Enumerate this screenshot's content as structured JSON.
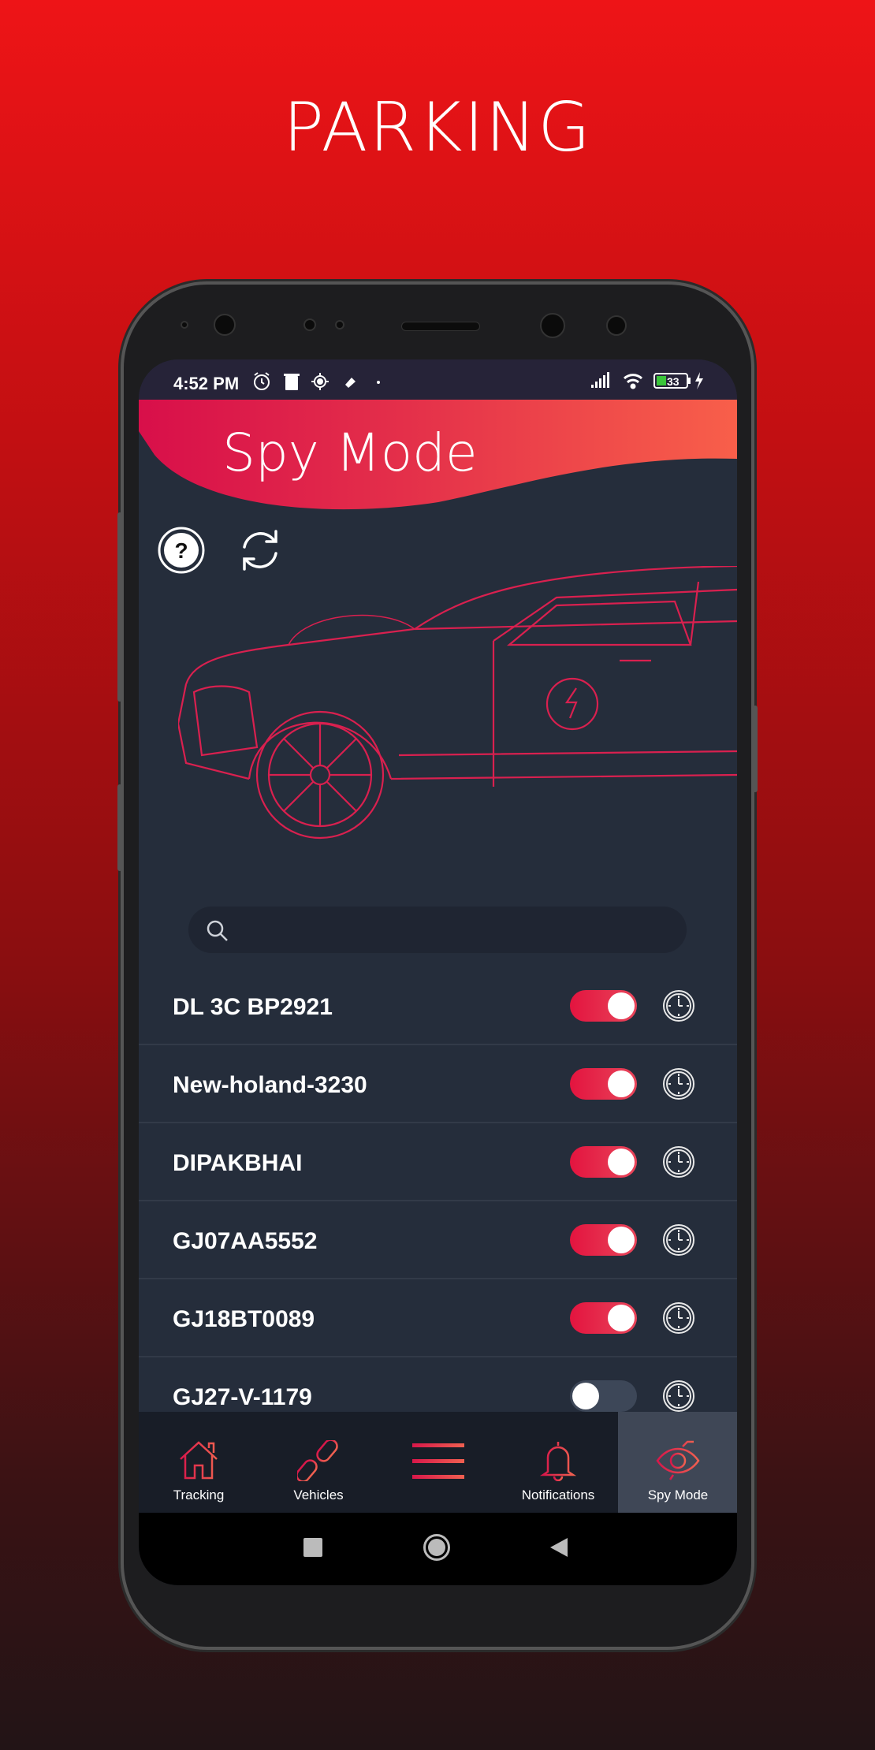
{
  "promo_title": "PARKING",
  "status_bar": {
    "time": "4:52 PM",
    "battery": "33",
    "icons": [
      "alarm-icon",
      "trash-icon",
      "location-icon",
      "tag-icon",
      "dot-icon",
      "signal-icon",
      "wifi-icon",
      "battery-icon",
      "charging-icon"
    ]
  },
  "header": {
    "title": "Spy Mode",
    "gradient": [
      "#d80f4a",
      "#f85f4a"
    ]
  },
  "toolbar": {
    "icons": [
      "help-icon",
      "refresh-icon"
    ]
  },
  "search": {
    "placeholder": "",
    "value": ""
  },
  "vehicles": [
    {
      "name": "DL 3C BP2921",
      "spy_mode": true
    },
    {
      "name": "New-holand-3230",
      "spy_mode": true
    },
    {
      "name": "DIPAKBHAI",
      "spy_mode": true
    },
    {
      "name": "GJ07AA5552",
      "spy_mode": true
    },
    {
      "name": "GJ18BT0089",
      "spy_mode": true
    },
    {
      "name": "GJ27-V-1179",
      "spy_mode": false
    }
  ],
  "bottom_nav": [
    {
      "label": "Tracking",
      "icon": "home-icon",
      "active": false
    },
    {
      "label": "Vehicles",
      "icon": "link-icon",
      "active": false
    },
    {
      "label": "",
      "icon": "menu-icon",
      "active": false
    },
    {
      "label": "Notifications",
      "icon": "bell-icon",
      "active": false
    },
    {
      "label": "Spy Mode",
      "icon": "eye-icon",
      "active": true
    }
  ],
  "accent": "#e3143f"
}
